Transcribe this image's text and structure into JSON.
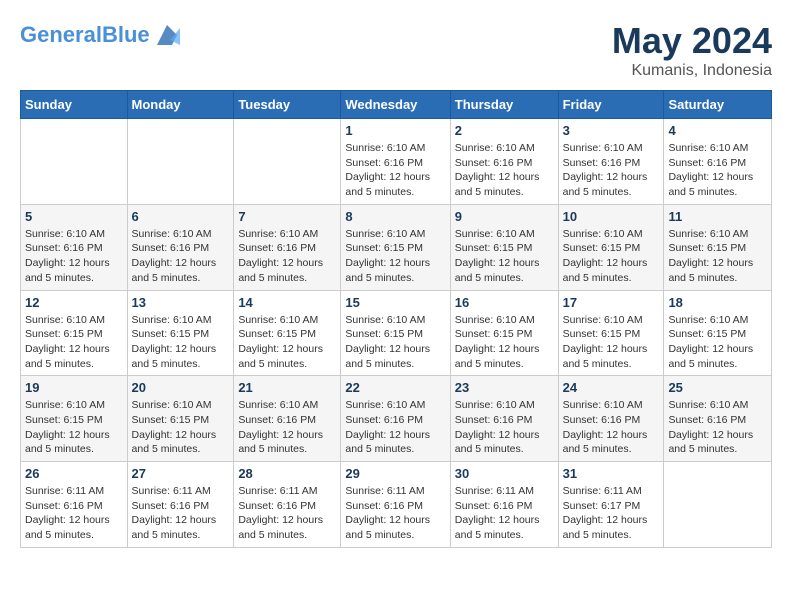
{
  "logo": {
    "line1": "General",
    "line2": "Blue"
  },
  "title": {
    "month_year": "May 2024",
    "location": "Kumanis, Indonesia"
  },
  "weekdays": [
    "Sunday",
    "Monday",
    "Tuesday",
    "Wednesday",
    "Thursday",
    "Friday",
    "Saturday"
  ],
  "weeks": [
    [
      {
        "day": "",
        "info": ""
      },
      {
        "day": "",
        "info": ""
      },
      {
        "day": "",
        "info": ""
      },
      {
        "day": "1",
        "info": "Sunrise: 6:10 AM\nSunset: 6:16 PM\nDaylight: 12 hours\nand 5 minutes."
      },
      {
        "day": "2",
        "info": "Sunrise: 6:10 AM\nSunset: 6:16 PM\nDaylight: 12 hours\nand 5 minutes."
      },
      {
        "day": "3",
        "info": "Sunrise: 6:10 AM\nSunset: 6:16 PM\nDaylight: 12 hours\nand 5 minutes."
      },
      {
        "day": "4",
        "info": "Sunrise: 6:10 AM\nSunset: 6:16 PM\nDaylight: 12 hours\nand 5 minutes."
      }
    ],
    [
      {
        "day": "5",
        "info": "Sunrise: 6:10 AM\nSunset: 6:16 PM\nDaylight: 12 hours\nand 5 minutes."
      },
      {
        "day": "6",
        "info": "Sunrise: 6:10 AM\nSunset: 6:16 PM\nDaylight: 12 hours\nand 5 minutes."
      },
      {
        "day": "7",
        "info": "Sunrise: 6:10 AM\nSunset: 6:16 PM\nDaylight: 12 hours\nand 5 minutes."
      },
      {
        "day": "8",
        "info": "Sunrise: 6:10 AM\nSunset: 6:15 PM\nDaylight: 12 hours\nand 5 minutes."
      },
      {
        "day": "9",
        "info": "Sunrise: 6:10 AM\nSunset: 6:15 PM\nDaylight: 12 hours\nand 5 minutes."
      },
      {
        "day": "10",
        "info": "Sunrise: 6:10 AM\nSunset: 6:15 PM\nDaylight: 12 hours\nand 5 minutes."
      },
      {
        "day": "11",
        "info": "Sunrise: 6:10 AM\nSunset: 6:15 PM\nDaylight: 12 hours\nand 5 minutes."
      }
    ],
    [
      {
        "day": "12",
        "info": "Sunrise: 6:10 AM\nSunset: 6:15 PM\nDaylight: 12 hours\nand 5 minutes."
      },
      {
        "day": "13",
        "info": "Sunrise: 6:10 AM\nSunset: 6:15 PM\nDaylight: 12 hours\nand 5 minutes."
      },
      {
        "day": "14",
        "info": "Sunrise: 6:10 AM\nSunset: 6:15 PM\nDaylight: 12 hours\nand 5 minutes."
      },
      {
        "day": "15",
        "info": "Sunrise: 6:10 AM\nSunset: 6:15 PM\nDaylight: 12 hours\nand 5 minutes."
      },
      {
        "day": "16",
        "info": "Sunrise: 6:10 AM\nSunset: 6:15 PM\nDaylight: 12 hours\nand 5 minutes."
      },
      {
        "day": "17",
        "info": "Sunrise: 6:10 AM\nSunset: 6:15 PM\nDaylight: 12 hours\nand 5 minutes."
      },
      {
        "day": "18",
        "info": "Sunrise: 6:10 AM\nSunset: 6:15 PM\nDaylight: 12 hours\nand 5 minutes."
      }
    ],
    [
      {
        "day": "19",
        "info": "Sunrise: 6:10 AM\nSunset: 6:15 PM\nDaylight: 12 hours\nand 5 minutes."
      },
      {
        "day": "20",
        "info": "Sunrise: 6:10 AM\nSunset: 6:15 PM\nDaylight: 12 hours\nand 5 minutes."
      },
      {
        "day": "21",
        "info": "Sunrise: 6:10 AM\nSunset: 6:16 PM\nDaylight: 12 hours\nand 5 minutes."
      },
      {
        "day": "22",
        "info": "Sunrise: 6:10 AM\nSunset: 6:16 PM\nDaylight: 12 hours\nand 5 minutes."
      },
      {
        "day": "23",
        "info": "Sunrise: 6:10 AM\nSunset: 6:16 PM\nDaylight: 12 hours\nand 5 minutes."
      },
      {
        "day": "24",
        "info": "Sunrise: 6:10 AM\nSunset: 6:16 PM\nDaylight: 12 hours\nand 5 minutes."
      },
      {
        "day": "25",
        "info": "Sunrise: 6:10 AM\nSunset: 6:16 PM\nDaylight: 12 hours\nand 5 minutes."
      }
    ],
    [
      {
        "day": "26",
        "info": "Sunrise: 6:11 AM\nSunset: 6:16 PM\nDaylight: 12 hours\nand 5 minutes."
      },
      {
        "day": "27",
        "info": "Sunrise: 6:11 AM\nSunset: 6:16 PM\nDaylight: 12 hours\nand 5 minutes."
      },
      {
        "day": "28",
        "info": "Sunrise: 6:11 AM\nSunset: 6:16 PM\nDaylight: 12 hours\nand 5 minutes."
      },
      {
        "day": "29",
        "info": "Sunrise: 6:11 AM\nSunset: 6:16 PM\nDaylight: 12 hours\nand 5 minutes."
      },
      {
        "day": "30",
        "info": "Sunrise: 6:11 AM\nSunset: 6:16 PM\nDaylight: 12 hours\nand 5 minutes."
      },
      {
        "day": "31",
        "info": "Sunrise: 6:11 AM\nSunset: 6:17 PM\nDaylight: 12 hours\nand 5 minutes."
      },
      {
        "day": "",
        "info": ""
      }
    ]
  ]
}
